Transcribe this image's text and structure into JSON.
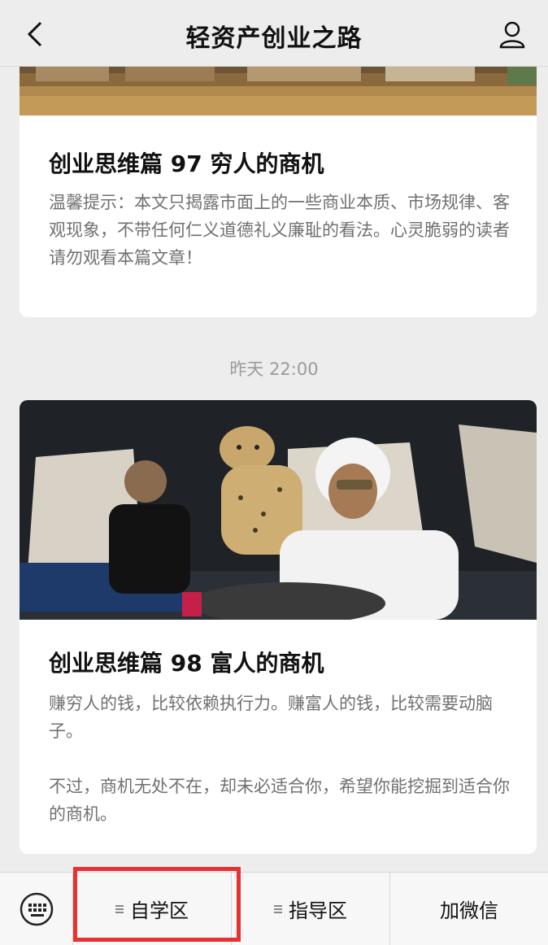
{
  "header": {
    "title": "轻资产创业之路"
  },
  "feed": {
    "items": [
      {
        "title": "创业思维篇 97 穷人的商机",
        "text": "温馨提示：本文只揭露市面上的一些商业本质、市场规律、客观现象，不带任何仁义道德礼义廉耻的看法。心灵脆弱的读者请勿观看本篇文章！"
      },
      {
        "title": "创业思维篇 98 富人的商机",
        "text": "赚穷人的钱，比较依赖执行力。赚富人的钱，比较需要动脑子。\n\n不过，商机无处不在，却未必适合你，希望你能挖掘到适合你的商机。"
      }
    ],
    "time_label": "昨天 22:00"
  },
  "bottom_menu": {
    "items": [
      {
        "label": "自学区"
      },
      {
        "label": "指导区"
      },
      {
        "label": "加微信"
      }
    ]
  },
  "colors": {
    "highlight": "#e53333",
    "background": "#ededed"
  },
  "icons": [
    "back-arrow-icon",
    "profile-icon",
    "keyboard-icon",
    "menu-lines-icon"
  ]
}
